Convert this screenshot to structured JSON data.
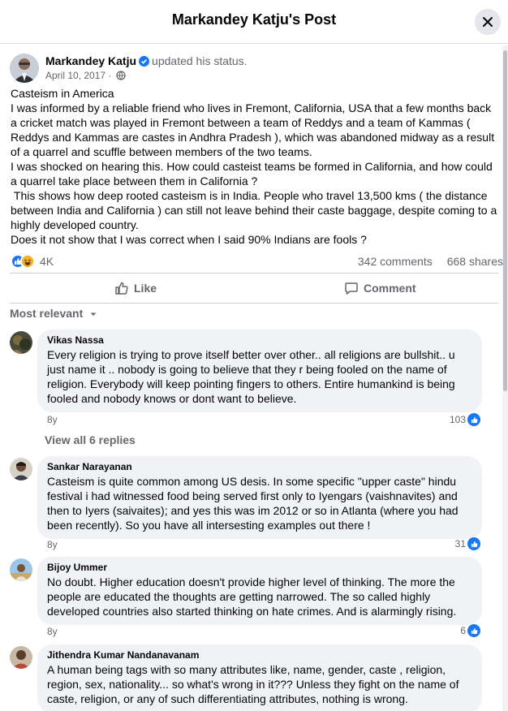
{
  "modal": {
    "title": "Markandey Katju's Post"
  },
  "post": {
    "author": "Markandey Katju",
    "action": "updated his status.",
    "date": "April 10, 2017 ·",
    "body": [
      "Casteism in America",
      "I was informed by a reliable friend who lives in Fremont, California, USA that a few months back a cricket match was played in Fremont between a team of Reddys and a team of Kammas ( Reddys and Kammas are castes in Andhra Pradesh ), which was abandoned midway as a result of a quarrel and scuffle between members of the two teams.",
      "I was shocked on hearing this. How could casteist teams be formed in California, and how could a quarrel take place between them in California ?",
      " This shows how deep rooted casteism is in India. People who travel 13,500 kms ( the distance between India and California ) can still not leave behind their caste baggage, despite coming to a highly developed country.",
      "Does it not show that I was correct when I said 90% Indians are fools ?"
    ],
    "reaction_count": "4K",
    "comments_count": "342 comments",
    "shares_count": "668 shares"
  },
  "actions": {
    "like_label": "Like",
    "comment_label": "Comment"
  },
  "sort": {
    "label": "Most relevant"
  },
  "comments": [
    {
      "name": "Vikas Nassa",
      "text": "Every religion is trying to prove itself better over other.. all religions are bullshit.. u just name it .. nobody is going to believe that they r being fooled on the name of religion. Everybody will keep pointing fingers to others. Entire humankind is being fooled and nobody knows or dont want to believe.",
      "age": "8y",
      "likes": "103"
    },
    {
      "name": "Sankar Narayanan",
      "text": "Casteism is quite common among US desis. In some specific \"upper caste\" hindu festival i had witnessed food being served first only to Iyengars (vaishnavites) and then to Iyers (saivaites); and yes this was im 2012 or so in Atlanta (where you had been recently). So you have all intersesting examples out there !",
      "age": "8y",
      "likes": "31"
    },
    {
      "name": "Bijoy Ummer",
      "text": "No doubt. Higher education doesn't provide higher level of thinking. The more the people are educated the thoughts are getting narrowed. The so called highly developed countries also started thinking on hate crimes. And is alarmingly rising.",
      "age": "8y",
      "likes": "6"
    },
    {
      "name": "Jithendra Kumar Nandanavanam",
      "text": "A human being tags with so many attributes like, name, gender, caste , religion, region, sex, nationality... so what's wrong in it??? Unless they fight on the name of caste, religion, or any of such differentiating attributes, nothing is wrong."
    }
  ],
  "view_replies": "View all 6 replies",
  "colors": {
    "accent": "#1877f2",
    "bubble": "#f0f2f5",
    "muted": "#65676b",
    "haha": "#f7b125"
  },
  "icons": [
    "close-icon",
    "verified-badge-icon",
    "globe-icon",
    "like-reaction-icon",
    "haha-reaction-icon",
    "thumbs-up-icon",
    "comment-icon",
    "chevron-down-icon"
  ]
}
